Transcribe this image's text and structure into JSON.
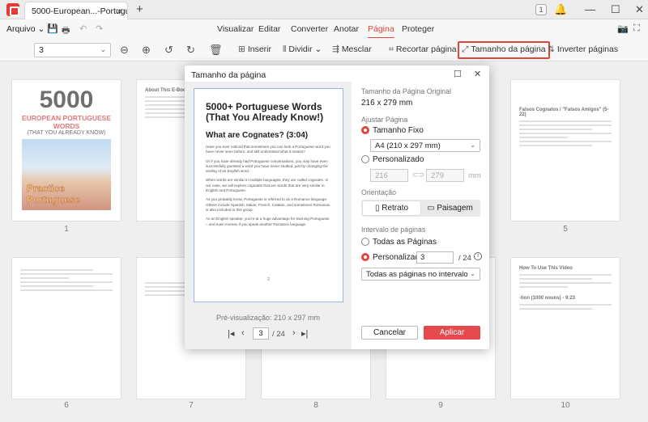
{
  "titlebar": {
    "tab_title": "5000-European...-Portuguese *",
    "tab_close": "×",
    "tab_add": "+",
    "page_badge": "1",
    "bell_icon": "🔔",
    "minimize": "—",
    "maximize": "☐",
    "close": "✕"
  },
  "menu": {
    "arquivo": "Arquivo",
    "arquivo_chevron": "⌄",
    "tabs": [
      "Visualizar",
      "Editar",
      "Converter",
      "Anotar",
      "Página",
      "Proteger"
    ],
    "active_tab": "Página",
    "accent": "#e0453c"
  },
  "toolbar": {
    "page_value": "3",
    "inserir": "Inserir",
    "dividir": "Dividir",
    "mesclar": "Mesclar",
    "recortar": "Recortar página",
    "tamanho": "Tamanho da página",
    "inverter": "Inverter páginas"
  },
  "thumbnails": {
    "numbers": [
      "1",
      "2",
      "5",
      "6",
      "7",
      "8",
      "9",
      "10"
    ],
    "cover_title": "5000",
    "cover_sub": "EUROPEAN PORTUGUESE WORDS",
    "cover_sub2": "(THAT YOU ALREADY KNOW)",
    "cover_logo": "Practice Portuguese",
    "page2_head": "About This E-Book",
    "page5_head": "Falsos Cognatos / \"Falsos Amigos\" (5-22)",
    "page10_head": "How To Use This Video",
    "page10_sub": "-tion (1000 nouns) - 9:23"
  },
  "dialog": {
    "title": "Tamanho da página",
    "preview": {
      "title": "5000+ Portuguese Words (That You Already Know!)",
      "heading": "What are Cognates? (3:04)",
      "paragraphs": [
        "Have you ever noticed that sometimes you can look a Portuguese word you have never seen before, and still understand what it means?",
        "Or if you have already had Portuguese conversations, you may have even successfully guessed a word you have never studied, just by changing the ending of an English word.",
        "When words are similar in multiple languages, they are called cognates. In our case, we will explore cognates that are words that are very similar in English and Portuguese.",
        "As you probably know, Portuguese is referred to as a Romance language. Others include Spanish, Italian, French, Catalan, and sometimes Romanian is also included in this group.",
        "As an English speaker, you're at a huge advantage for learning Portuguese – and even moreso if you speak another Romance language."
      ],
      "page_number": "2",
      "caption": "Pré-visualização: 210 x 297 mm",
      "current_page": "3",
      "total": "/ 24"
    },
    "original_label": "Tamanho da Página Original",
    "original_value": "216 x 279 mm",
    "ajustar_label": "Ajustar Página",
    "tamanho_fixo": "Tamanho Fixo",
    "fixed_option": "A4 (210 x 297 mm)",
    "personalizado": "Personalizado",
    "custom_w": "216",
    "custom_h": "279",
    "unit": "mm",
    "orientacao_label": "Orientação",
    "retrato": "Retrato",
    "paisagem": "Paisagem",
    "intervalo_label": "Intervalo de páginas",
    "todas": "Todas as Páginas",
    "personalizado_range": "Personalizado",
    "range_value": "3",
    "range_total": "/ 24",
    "range_option": "Todas as páginas no intervalo",
    "cancel": "Cancelar",
    "apply": "Aplicar"
  }
}
